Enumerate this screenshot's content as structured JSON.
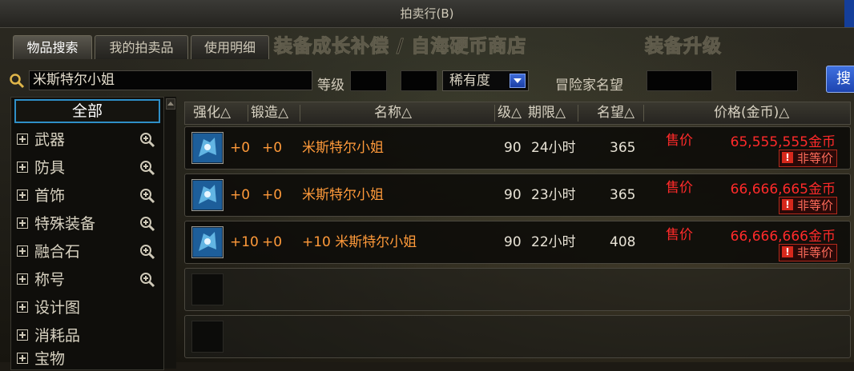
{
  "window": {
    "title": "拍卖行(B)"
  },
  "tabs": [
    {
      "label": "物品搜索",
      "active": true
    },
    {
      "label": "我的拍卖品",
      "active": false
    },
    {
      "label": "使用明细",
      "active": false
    }
  ],
  "background_text": {
    "line1": "装备成长补偿 / 自海硬币商店",
    "line2": "装备升级"
  },
  "search": {
    "query": "米斯特尔小姐",
    "level_label": "等级",
    "rarity_label": "稀有度",
    "fame_label": "冒险家名望",
    "button_label": "搜"
  },
  "sidebar": {
    "items": [
      {
        "label": "全部",
        "active": true,
        "expandable": false
      },
      {
        "label": "武器",
        "expandable": true,
        "zoom": true
      },
      {
        "label": "防具",
        "expandable": true,
        "zoom": true
      },
      {
        "label": "首饰",
        "expandable": true,
        "zoom": true
      },
      {
        "label": "特殊装备",
        "expandable": true,
        "zoom": true
      },
      {
        "label": "融合石",
        "expandable": true,
        "zoom": true
      },
      {
        "label": "称号",
        "expandable": true,
        "zoom": true
      },
      {
        "label": "设计图",
        "expandable": true,
        "zoom": false
      },
      {
        "label": "消耗品",
        "expandable": true,
        "zoom": false
      },
      {
        "label": "宝物",
        "expandable": true,
        "zoom": false
      }
    ]
  },
  "table": {
    "headers": {
      "enhance": "强化△",
      "forge": "锻造△",
      "name": "名称△",
      "level": "级△",
      "duration": "期限△",
      "fame": "名望△",
      "price": "价格(金币)△"
    },
    "rows": [
      {
        "enhance": "+0",
        "forge": "+0",
        "name": "米斯特尔小姐",
        "level": "90",
        "duration": "24小时",
        "fame": "365",
        "sale_label": "售价",
        "price": "65,555,555金币",
        "badge": "非等价"
      },
      {
        "enhance": "+0",
        "forge": "+0",
        "name": "米斯特尔小姐",
        "level": "90",
        "duration": "23小时",
        "fame": "365",
        "sale_label": "售价",
        "price": "66,666,665金币",
        "badge": "非等价"
      },
      {
        "enhance": "+10",
        "forge": "+0",
        "name": "+10 米斯特尔小姐",
        "level": "90",
        "duration": "22小时",
        "fame": "408",
        "sale_label": "售价",
        "price": "66,666,666金币",
        "badge": "非等价"
      }
    ]
  },
  "colors": {
    "accent_blue": "#2f6fd8",
    "price_red": "#ff2a2a",
    "name_orange": "#ff9a3a"
  },
  "icons": {
    "search": "magnifier-icon",
    "zoom": "zoom-in-icon",
    "expand": "plus-box-icon"
  }
}
